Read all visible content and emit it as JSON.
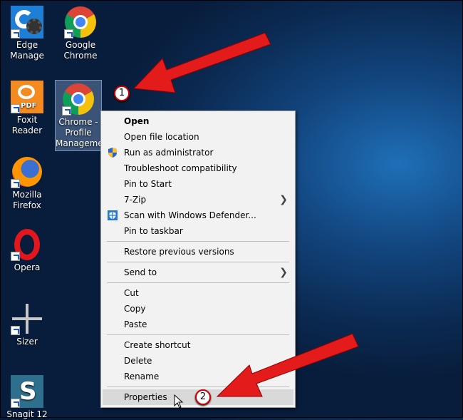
{
  "desktop": {
    "icons": [
      {
        "label": "Edge Manage",
        "icon": "edge-manage-icon"
      },
      {
        "label": "Google Chrome",
        "icon": "chrome-icon"
      },
      {
        "label": "Foxit Reader",
        "icon": "foxit-pdf-icon"
      },
      {
        "label": "Chrome - Profile Manageme",
        "icon": "chrome-icon"
      },
      {
        "label": "Mozilla Firefox",
        "icon": "firefox-icon"
      },
      {
        "label": "Opera",
        "icon": "opera-icon"
      },
      {
        "label": "Sizer",
        "icon": "move-arrows-icon"
      },
      {
        "label": "Snagit 12",
        "icon": "snagit-icon"
      }
    ]
  },
  "context_menu": {
    "items": [
      {
        "label": "Open",
        "bold": true
      },
      {
        "label": "Open file location"
      },
      {
        "label": "Run as administrator",
        "icon": "uac-shield-icon"
      },
      {
        "label": "Troubleshoot compatibility"
      },
      {
        "label": "Pin to Start"
      },
      {
        "label": "7-Zip",
        "submenu": true
      },
      {
        "label": "Scan with Windows Defender...",
        "icon": "defender-icon"
      },
      {
        "label": "Pin to taskbar"
      },
      {
        "label": "Restore previous versions"
      },
      {
        "label": "Send to",
        "submenu": true
      },
      {
        "label": "Cut"
      },
      {
        "label": "Copy"
      },
      {
        "label": "Paste"
      },
      {
        "label": "Create shortcut"
      },
      {
        "label": "Delete"
      },
      {
        "label": "Rename"
      },
      {
        "label": "Properties",
        "highlighted": true
      }
    ]
  },
  "annotations": {
    "step1": "1",
    "step2": "2",
    "arrow_color": "#e31b1b"
  }
}
